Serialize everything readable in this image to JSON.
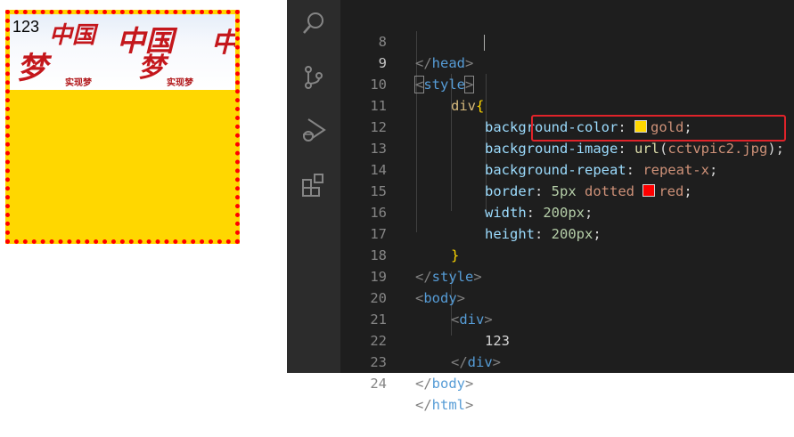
{
  "preview": {
    "box_text": "123",
    "background_color": "#ffd700",
    "border_color": "#ff0000",
    "banner_tile": {
      "big_text_1": "中国",
      "big_text_2": "梦",
      "small_text": "实现梦"
    }
  },
  "editor": {
    "activity_icons": [
      "search-icon",
      "source-control-icon",
      "run-debug-icon",
      "extensions-icon"
    ],
    "lines": [
      {
        "num": "8",
        "text": "</head>"
      },
      {
        "num": "9",
        "text": "<style>"
      },
      {
        "num": "10",
        "text": "div{"
      },
      {
        "num": "11",
        "text": "background-color: gold;"
      },
      {
        "num": "12",
        "text": "background-image: url(cctvpic2.jpg);"
      },
      {
        "num": "13",
        "text": "background-repeat: repeat-x;"
      },
      {
        "num": "14",
        "text": "border: 5px dotted red;"
      },
      {
        "num": "15",
        "text": "width: 200px;"
      },
      {
        "num": "16",
        "text": "height: 200px;"
      },
      {
        "num": "17",
        "text": "}"
      },
      {
        "num": "18",
        "text": "</style>"
      },
      {
        "num": "19",
        "text": "<body>"
      },
      {
        "num": "20",
        "text": "<div>"
      },
      {
        "num": "21",
        "text": "123"
      },
      {
        "num": "22",
        "text": "</div>"
      },
      {
        "num": "23",
        "text": "</body>"
      },
      {
        "num": "24",
        "text": "</html>"
      }
    ],
    "active_line": "9",
    "swatch_colors": {
      "gold": "#ffd700",
      "red": "#ff0000"
    },
    "highlight_color": "#e0232a"
  }
}
